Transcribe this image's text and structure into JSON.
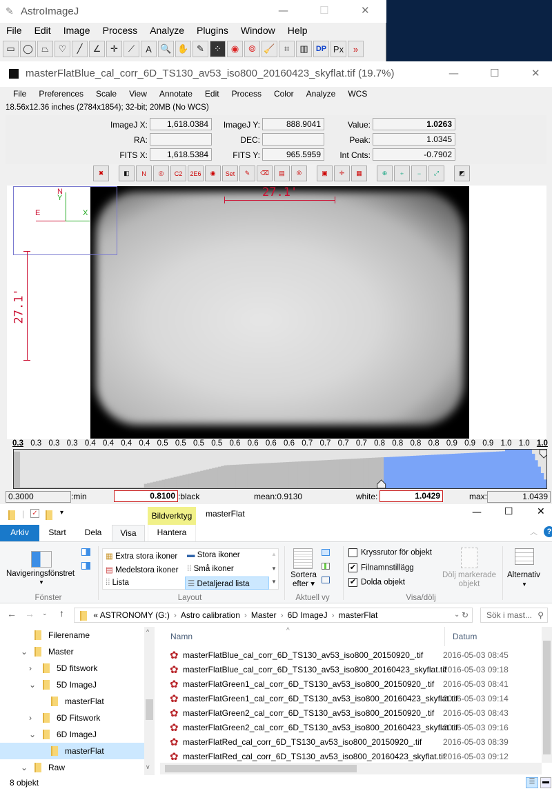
{
  "aij_main": {
    "title": "AstroImageJ",
    "menu": [
      "File",
      "Edit",
      "Image",
      "Process",
      "Analyze",
      "Plugins",
      "Window",
      "Help"
    ],
    "tools": [
      {
        "name": "rectangle-tool-icon",
        "glyph": "▭"
      },
      {
        "name": "oval-tool-icon",
        "glyph": "◯"
      },
      {
        "name": "polygon-tool-icon",
        "glyph": "⏢"
      },
      {
        "name": "freehand-tool-icon",
        "glyph": "♡"
      },
      {
        "name": "line-tool-icon",
        "glyph": "╱"
      },
      {
        "name": "angle-tool-icon",
        "glyph": "∠"
      },
      {
        "name": "point-tool-icon",
        "glyph": "✛"
      },
      {
        "name": "wand-tool-icon",
        "glyph": "⟋"
      },
      {
        "name": "text-tool-icon",
        "glyph": "A"
      },
      {
        "name": "magnifier-tool-icon",
        "glyph": "🔍"
      },
      {
        "name": "hand-tool-icon",
        "glyph": "✋"
      },
      {
        "name": "dropper-tool-icon",
        "glyph": "✎"
      },
      {
        "name": "star-field-tool-icon",
        "glyph": "⁘"
      },
      {
        "name": "aperture-tool-icon",
        "glyph": "◉"
      },
      {
        "name": "multi-aperture-tool-icon",
        "glyph": "⦾"
      },
      {
        "name": "broom-tool-icon",
        "glyph": "🧹"
      },
      {
        "name": "plot-tool-icon",
        "glyph": "⌗"
      },
      {
        "name": "table-tool-icon",
        "glyph": "▥"
      },
      {
        "name": "dp-tool-icon",
        "glyph": "DP"
      },
      {
        "name": "px-tool-icon",
        "glyph": "Px"
      },
      {
        "name": "more-tools-icon",
        "glyph": "»"
      }
    ]
  },
  "image_window": {
    "title": "masterFlatBlue_cal_corr_6D_TS130_av53_iso800_20160423_skyflat.tif (19.7%)",
    "menu": [
      "File",
      "Preferences",
      "Scale",
      "View",
      "Annotate",
      "Edit",
      "Process",
      "Color",
      "Analyze",
      "WCS"
    ],
    "info": "18.56x12.36 inches (2784x1854); 32-bit; 20MB (No WCS)",
    "coords": {
      "imagej_x_label": "ImageJ X:",
      "imagej_x": "1,618.0384",
      "imagej_y_label": "ImageJ Y:",
      "imagej_y": "888.9041",
      "value_label": "Value:",
      "value": "1.0263",
      "ra_label": "RA:",
      "ra": "",
      "dec_label": "DEC:",
      "dec": "",
      "peak_label": "Peak:",
      "peak": "1.0345",
      "fits_x_label": "FITS X:",
      "fits_x": "1,618.5384",
      "fits_y_label": "FITS Y:",
      "fits_y": "965.5959",
      "int_cnts_label": "Int Cnts:",
      "int_cnts": "-0.7902"
    },
    "image_tools": [
      "close-all",
      "invert",
      "name",
      "aperture",
      "c2",
      "2.2E6",
      "centroid",
      "set",
      "edit-aperture",
      "clear-apertures",
      "clear-overlay",
      "multi-aperture",
      "stack",
      "crosshair",
      "table",
      "zoom-in-fit",
      "zoom-in",
      "zoom-out",
      "zoom-fit",
      "contrast"
    ],
    "overlay": {
      "north": "N",
      "y": "Y",
      "east": "E",
      "x": "X",
      "scale_horizontal": "27.1'",
      "scale_vertical": "27.1'"
    },
    "histogram": {
      "ticks": [
        "0.3",
        "0.3",
        "0.3",
        "0.3",
        "0.4",
        "0.4",
        "0.4",
        "0.4",
        "0.5",
        "0.5",
        "0.5",
        "0.5",
        "0.6",
        "0.6",
        "0.6",
        "0.6",
        "0.7",
        "0.7",
        "0.7",
        "0.7",
        "0.8",
        "0.8",
        "0.8",
        "0.8",
        "0.9",
        "0.9",
        "0.9",
        "1.0",
        "1.0",
        "1.0"
      ],
      "min_value": "0.3000",
      "min_label": ":min",
      "black_value": "0.8100",
      "black_label": ":black",
      "mean_label": "mean:0.9130",
      "white_label": "white:",
      "white_value": "1.0429",
      "max_label": "max:",
      "max_value": "1.0439",
      "black_fraction": 0.69,
      "white_fraction": 0.995
    }
  },
  "explorer": {
    "title": "masterFlat",
    "context_tab": "Bildverktyg",
    "tabs": [
      "Arkiv",
      "Start",
      "Dela",
      "Visa",
      "Hantera"
    ],
    "ribbon": {
      "nav_pane": "Navigeringsfönstret",
      "fonster": "Fönster",
      "layout_items": [
        "Extra stora ikoner",
        "Stora ikoner",
        "Medelstora ikoner",
        "Små ikoner",
        "Lista",
        "Detaljerad lista"
      ],
      "layout": "Layout",
      "sortera": "Sortera",
      "efter": "efter",
      "aktuell_vy": "Aktuell vy",
      "checkboxes": [
        {
          "label": "Kryssrutor för objekt",
          "checked": false
        },
        {
          "label": "Filnamnstillägg",
          "checked": true
        },
        {
          "label": "Dolda objekt",
          "checked": true
        }
      ],
      "hide_selected_1": "Dölj markerade",
      "hide_selected_2": "objekt",
      "visa_dolj": "Visa/dölj",
      "alternativ": "Alternativ"
    },
    "breadcrumb": [
      "«",
      "ASTRONOMY (G:)",
      "Astro calibration",
      "Master",
      "6D ImageJ",
      "masterFlat"
    ],
    "search_placeholder": "Sök i mast...",
    "nav_tree": [
      {
        "label": "Filerename",
        "level": 1,
        "arrow": ""
      },
      {
        "label": "Master",
        "level": 1,
        "arrow": "⌄"
      },
      {
        "label": "5D fitswork",
        "level": 2,
        "arrow": "›"
      },
      {
        "label": "5D ImageJ",
        "level": 2,
        "arrow": "⌄"
      },
      {
        "label": "masterFlat",
        "level": 3,
        "arrow": ""
      },
      {
        "label": "6D Fitswork",
        "level": 2,
        "arrow": "›"
      },
      {
        "label": "6D ImageJ",
        "level": 2,
        "arrow": "⌄"
      },
      {
        "label": "masterFlat",
        "level": 3,
        "arrow": "",
        "selected": true
      },
      {
        "label": "Raw",
        "level": 1,
        "arrow": "⌄"
      }
    ],
    "columns": {
      "name": "Namn",
      "date": "Datum"
    },
    "files": [
      {
        "name": "masterFlatBlue_cal_corr_6D_TS130_av53_iso800_20150920_.tif",
        "date": "2016-05-03 08:45"
      },
      {
        "name": "masterFlatBlue_cal_corr_6D_TS130_av53_iso800_20160423_skyflat.tif",
        "date": "2016-05-03 09:18"
      },
      {
        "name": "masterFlatGreen1_cal_corr_6D_TS130_av53_iso800_20150920_.tif",
        "date": "2016-05-03 08:41"
      },
      {
        "name": "masterFlatGreen1_cal_corr_6D_TS130_av53_iso800_20160423_skyflat.tif",
        "date": "2016-05-03 09:14"
      },
      {
        "name": "masterFlatGreen2_cal_corr_6D_TS130_av53_iso800_20150920_.tif",
        "date": "2016-05-03 08:43"
      },
      {
        "name": "masterFlatGreen2_cal_corr_6D_TS130_av53_iso800_20160423_skyflat.tif",
        "date": "2016-05-03 09:16"
      },
      {
        "name": "masterFlatRed_cal_corr_6D_TS130_av53_iso800_20150920_.tif",
        "date": "2016-05-03 08:39"
      },
      {
        "name": "masterFlatRed_cal_corr_6D_TS130_av53_iso800_20160423_skyflat.tif",
        "date": "2016-05-03 09:12"
      }
    ],
    "status": "8 objekt"
  },
  "colors": {
    "accent_blue": "#1979ca",
    "overlay_red": "#cc1133",
    "overlay_green": "#22aa22",
    "hist_blue": "#7aa4f8",
    "selection": "#cce8ff",
    "context_yellow": "#f1f189"
  }
}
